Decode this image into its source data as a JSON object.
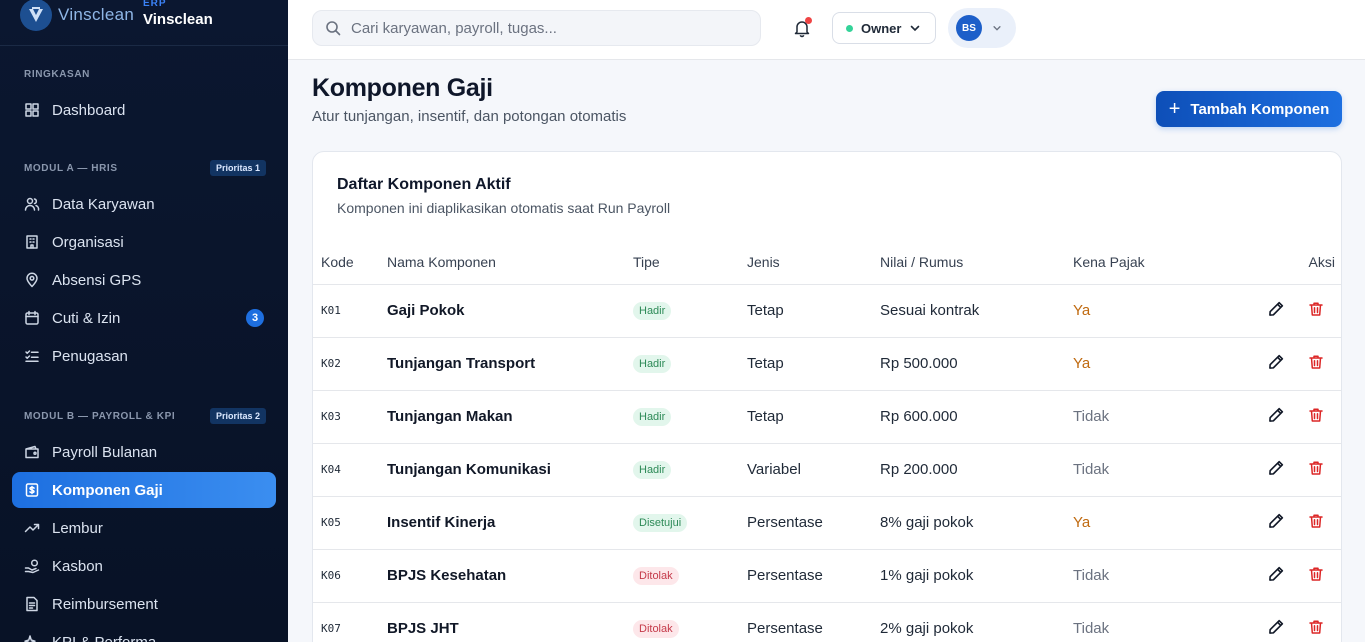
{
  "brand": {
    "logo_text": "Vinsclean",
    "erp": "ERP",
    "name": "Vinsclean"
  },
  "sidebar": {
    "sections": [
      {
        "title": "RINGKASAN",
        "badge": "",
        "items": [
          {
            "label": "Dashboard",
            "icon": "grid-icon",
            "count": ""
          }
        ]
      },
      {
        "title": "MODUL A — HRIS",
        "badge": "Prioritas 1",
        "items": [
          {
            "label": "Data Karyawan",
            "icon": "users-icon",
            "count": ""
          },
          {
            "label": "Organisasi",
            "icon": "building-icon",
            "count": ""
          },
          {
            "label": "Absensi GPS",
            "icon": "map-pin-icon",
            "count": ""
          },
          {
            "label": "Cuti & Izin",
            "icon": "calendar-icon",
            "count": "3"
          },
          {
            "label": "Penugasan",
            "icon": "list-check-icon",
            "count": ""
          }
        ]
      },
      {
        "title": "MODUL B — PAYROLL & KPI",
        "badge": "Prioritas 2",
        "items": [
          {
            "label": "Payroll Bulanan",
            "icon": "wallet-icon",
            "count": ""
          },
          {
            "label": "Komponen Gaji",
            "icon": "receipt-icon",
            "count": "",
            "active": true
          },
          {
            "label": "Lembur",
            "icon": "trend-icon",
            "count": ""
          },
          {
            "label": "Kasbon",
            "icon": "hand-coins-icon",
            "count": ""
          },
          {
            "label": "Reimbursement",
            "icon": "document-icon",
            "count": ""
          },
          {
            "label": "KPI & Performa",
            "icon": "sparkle-icon",
            "count": ""
          }
        ]
      }
    ]
  },
  "topbar": {
    "search_placeholder": "Cari karyawan, payroll, tugas...",
    "role": "Owner",
    "user_initials": "BS"
  },
  "page": {
    "title": "Komponen Gaji",
    "subtitle": "Atur tunjangan, insentif, dan potongan otomatis",
    "add_button": "Tambah Komponen"
  },
  "card": {
    "title": "Daftar Komponen Aktif",
    "subtitle": "Komponen ini diaplikasikan otomatis saat Run Payroll",
    "columns": [
      "Kode",
      "Nama Komponen",
      "Tipe",
      "Jenis",
      "Nilai / Rumus",
      "Kena Pajak",
      "Aksi"
    ],
    "rows": [
      {
        "kode": "K01",
        "nama": "Gaji Pokok",
        "tipe": "Hadir",
        "tipe_color": "green",
        "jenis": "Tetap",
        "nilai": "Sesuai kontrak",
        "pajak": "Ya"
      },
      {
        "kode": "K02",
        "nama": "Tunjangan Transport",
        "tipe": "Hadir",
        "tipe_color": "green",
        "jenis": "Tetap",
        "nilai": "Rp 500.000",
        "pajak": "Ya"
      },
      {
        "kode": "K03",
        "nama": "Tunjangan Makan",
        "tipe": "Hadir",
        "tipe_color": "green",
        "jenis": "Tetap",
        "nilai": "Rp 600.000",
        "pajak": "Tidak"
      },
      {
        "kode": "K04",
        "nama": "Tunjangan Komunikasi",
        "tipe": "Hadir",
        "tipe_color": "green",
        "jenis": "Variabel",
        "nilai": "Rp 200.000",
        "pajak": "Tidak"
      },
      {
        "kode": "K05",
        "nama": "Insentif Kinerja",
        "tipe": "Disetujui",
        "tipe_color": "green",
        "jenis": "Persentase",
        "nilai": "8% gaji pokok",
        "pajak": "Ya"
      },
      {
        "kode": "K06",
        "nama": "BPJS Kesehatan",
        "tipe": "Ditolak",
        "tipe_color": "red",
        "jenis": "Persentase",
        "nilai": "1% gaji pokok",
        "pajak": "Tidak"
      },
      {
        "kode": "K07",
        "nama": "BPJS JHT",
        "tipe": "Ditolak",
        "tipe_color": "red",
        "jenis": "Persentase",
        "nilai": "2% gaji pokok",
        "pajak": "Tidak"
      }
    ]
  },
  "colors": {
    "accent": "#1d6fe0",
    "sidebar_bg": "#0b1730",
    "tax_yes": "#c06a10",
    "delete": "#dc2626"
  }
}
